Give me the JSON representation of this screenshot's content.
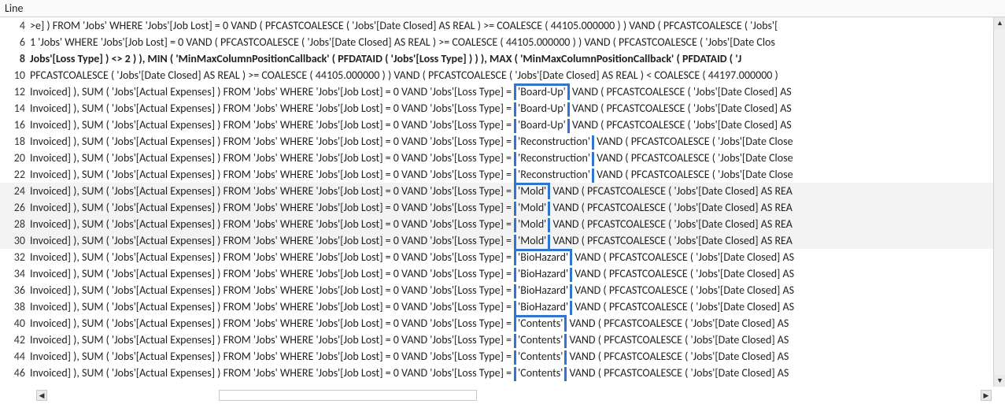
{
  "header": {
    "title": "Line"
  },
  "rows": [
    {
      "n": 4,
      "alt": false,
      "bold": false,
      "pre": ">e] ) FROM 'Jobs' WHERE 'Jobs'[Job Lost] = 0 VAND  ( PFCASTCOALESCE ( 'Jobs'[Date Closed] AS  REAL ) >= COALESCE ( 44105.000000 )  ) VAND  ( PFCASTCOALESCE ( 'Jobs'[",
      "hl": null,
      "hlpos": null,
      "post": ""
    },
    {
      "n": 6,
      "alt": false,
      "bold": false,
      "pre": "1 'Jobs' WHERE 'Jobs'[Job Lost] = 0 VAND  ( PFCASTCOALESCE ( 'Jobs'[Date Closed] AS  REAL ) >= COALESCE ( 44105.000000 )  ) VAND  ( PFCASTCOALESCE ( 'Jobs'[Date Clos",
      "hl": null,
      "hlpos": null,
      "post": ""
    },
    {
      "n": 8,
      "alt": false,
      "bold": true,
      "pre": "Jobs'[Loss Type] ) <> 2 )  ), MIN ( 'MinMaxColumnPositionCallback' ( PFDATAID ( 'Jobs'[Loss Type] )  )  ), MAX ( 'MinMaxColumnPositionCallback' ( PFDATAID ( 'J",
      "hl": null,
      "hlpos": null,
      "post": ""
    },
    {
      "n": 10,
      "alt": false,
      "bold": false,
      "pre": "PFCASTCOALESCE ( 'Jobs'[Date Closed] AS  REAL ) >= COALESCE ( 44105.000000 )  ) VAND  ( PFCASTCOALESCE ( 'Jobs'[Date Closed] AS  REAL ) < COALESCE ( 44197.000000 )",
      "hl": null,
      "hlpos": null,
      "post": ""
    },
    {
      "n": 12,
      "alt": false,
      "bold": false,
      "pre": "Invoiced] ), SUM ( 'Jobs'[Actual Expenses] ) FROM 'Jobs' WHERE 'Jobs'[Job Lost] = 0 VAND 'Jobs'[Loss Type] = ",
      "hl": "'Board-Up'",
      "hlpos": "top",
      "post": " VAND  ( PFCASTCOALESCE ( 'Jobs'[Date Closed] AS"
    },
    {
      "n": 14,
      "alt": false,
      "bold": false,
      "pre": "Invoiced] ), SUM ( 'Jobs'[Actual Expenses] ) FROM 'Jobs' WHERE 'Jobs'[Job Lost] = 0 VAND 'Jobs'[Loss Type] = ",
      "hl": "'Board-Up'",
      "hlpos": "mid",
      "post": " VAND  ( PFCASTCOALESCE ( 'Jobs'[Date Closed] AS"
    },
    {
      "n": 16,
      "alt": false,
      "bold": false,
      "pre": "Invoiced] ), SUM ( 'Jobs'[Actual Expenses] ) FROM 'Jobs' WHERE 'Jobs'[Job Lost] = 0 VAND 'Jobs'[Loss Type] = ",
      "hl": "'Board-Up'",
      "hlpos": "mid",
      "post": " VAND  ( PFCASTCOALESCE ( 'Jobs'[Date Closed] AS"
    },
    {
      "n": 18,
      "alt": false,
      "bold": false,
      "pre": "Invoiced] ), SUM ( 'Jobs'[Actual Expenses] ) FROM 'Jobs' WHERE 'Jobs'[Job Lost] = 0 VAND 'Jobs'[Loss Type] = ",
      "hl": "'Reconstruction'",
      "hlpos": "mid",
      "post": " VAND  ( PFCASTCOALESCE ( 'Jobs'[Date Close"
    },
    {
      "n": 20,
      "alt": false,
      "bold": false,
      "pre": "Invoiced] ), SUM ( 'Jobs'[Actual Expenses] ) FROM 'Jobs' WHERE 'Jobs'[Job Lost] = 0 VAND 'Jobs'[Loss Type] = ",
      "hl": "'Reconstruction'",
      "hlpos": "mid",
      "post": " VAND  ( PFCASTCOALESCE ( 'Jobs'[Date Close"
    },
    {
      "n": 22,
      "alt": false,
      "bold": false,
      "pre": "Invoiced] ), SUM ( 'Jobs'[Actual Expenses] ) FROM 'Jobs' WHERE 'Jobs'[Job Lost] = 0 VAND 'Jobs'[Loss Type] = ",
      "hl": "'Reconstruction'",
      "hlpos": "bot",
      "post": " VAND  ( PFCASTCOALESCE ( 'Jobs'[Date Close"
    },
    {
      "n": 24,
      "alt": true,
      "bold": false,
      "pre": "Invoiced] ), SUM ( 'Jobs'[Actual Expenses] ) FROM 'Jobs' WHERE 'Jobs'[Job Lost] = 0 VAND 'Jobs'[Loss Type] = ",
      "hl": "'Mold'",
      "hlpos": "top",
      "post": " VAND  ( PFCASTCOALESCE ( 'Jobs'[Date Closed] AS  REA"
    },
    {
      "n": 26,
      "alt": true,
      "bold": false,
      "pre": "Invoiced] ), SUM ( 'Jobs'[Actual Expenses] ) FROM 'Jobs' WHERE 'Jobs'[Job Lost] = 0 VAND 'Jobs'[Loss Type] = ",
      "hl": "'Mold'",
      "hlpos": "mid",
      "post": " VAND  ( PFCASTCOALESCE ( 'Jobs'[Date Closed] AS  REA"
    },
    {
      "n": 28,
      "alt": true,
      "bold": false,
      "pre": "Invoiced] ), SUM ( 'Jobs'[Actual Expenses] ) FROM 'Jobs' WHERE 'Jobs'[Job Lost] = 0 VAND 'Jobs'[Loss Type] = ",
      "hl": "'Mold'",
      "hlpos": "mid",
      "post": " VAND  ( PFCASTCOALESCE ( 'Jobs'[Date Closed] AS  REA"
    },
    {
      "n": 30,
      "alt": true,
      "bold": false,
      "pre": "Invoiced] ), SUM ( 'Jobs'[Actual Expenses] ) FROM 'Jobs' WHERE 'Jobs'[Job Lost] = 0 VAND 'Jobs'[Loss Type] = ",
      "hl": "'Mold'",
      "hlpos": "bot",
      "post": " VAND  ( PFCASTCOALESCE ( 'Jobs'[Date Closed] AS  REA"
    },
    {
      "n": 32,
      "alt": false,
      "bold": false,
      "pre": "Invoiced] ), SUM ( 'Jobs'[Actual Expenses] ) FROM 'Jobs' WHERE 'Jobs'[Job Lost] = 0 VAND 'Jobs'[Loss Type] = ",
      "hl": "'BioHazard'",
      "hlpos": "top",
      "post": " VAND  ( PFCASTCOALESCE ( 'Jobs'[Date Closed] AS"
    },
    {
      "n": 34,
      "alt": false,
      "bold": false,
      "pre": "Invoiced] ), SUM ( 'Jobs'[Actual Expenses] ) FROM 'Jobs' WHERE 'Jobs'[Job Lost] = 0 VAND 'Jobs'[Loss Type] = ",
      "hl": "'BioHazard'",
      "hlpos": "mid",
      "post": " VAND  ( PFCASTCOALESCE ( 'Jobs'[Date Closed] AS"
    },
    {
      "n": 36,
      "alt": false,
      "bold": false,
      "pre": "Invoiced] ), SUM ( 'Jobs'[Actual Expenses] ) FROM 'Jobs' WHERE 'Jobs'[Job Lost] = 0 VAND 'Jobs'[Loss Type] = ",
      "hl": "'BioHazard'",
      "hlpos": "mid",
      "post": " VAND  ( PFCASTCOALESCE ( 'Jobs'[Date Closed] AS"
    },
    {
      "n": 38,
      "alt": false,
      "bold": false,
      "pre": "Invoiced] ), SUM ( 'Jobs'[Actual Expenses] ) FROM 'Jobs' WHERE 'Jobs'[Job Lost] = 0 VAND 'Jobs'[Loss Type] = ",
      "hl": "'BioHazard'",
      "hlpos": "bot",
      "post": " VAND  ( PFCASTCOALESCE ( 'Jobs'[Date Closed] AS"
    },
    {
      "n": 40,
      "alt": false,
      "bold": false,
      "pre": "Invoiced] ), SUM ( 'Jobs'[Actual Expenses] ) FROM 'Jobs' WHERE 'Jobs'[Job Lost] = 0 VAND 'Jobs'[Loss Type] = ",
      "hl": "'Contents'",
      "hlpos": "top",
      "post": " VAND  ( PFCASTCOALESCE ( 'Jobs'[Date Closed] AS "
    },
    {
      "n": 42,
      "alt": false,
      "bold": false,
      "pre": "Invoiced] ), SUM ( 'Jobs'[Actual Expenses] ) FROM 'Jobs' WHERE 'Jobs'[Job Lost] = 0 VAND 'Jobs'[Loss Type] = ",
      "hl": "'Contents'",
      "hlpos": "mid",
      "post": " VAND  ( PFCASTCOALESCE ( 'Jobs'[Date Closed] AS "
    },
    {
      "n": 44,
      "alt": false,
      "bold": false,
      "pre": "Invoiced] ), SUM ( 'Jobs'[Actual Expenses] ) FROM 'Jobs' WHERE 'Jobs'[Job Lost] = 0 VAND 'Jobs'[Loss Type] = ",
      "hl": "'Contents'",
      "hlpos": "mid",
      "post": " VAND  ( PFCASTCOALESCE ( 'Jobs'[Date Closed] AS "
    },
    {
      "n": 46,
      "alt": false,
      "bold": false,
      "pre": "Invoiced] ), SUM ( 'Jobs'[Actual Expenses] ) FROM 'Jobs' WHERE 'Jobs'[Job Lost] = 0 VAND 'Jobs'[Loss Type] = ",
      "hl": "'Contents'",
      "hlpos": "bot",
      "post": " VAND  ( PFCASTCOALESCE ( 'Jobs'[Date Closed] AS "
    }
  ]
}
